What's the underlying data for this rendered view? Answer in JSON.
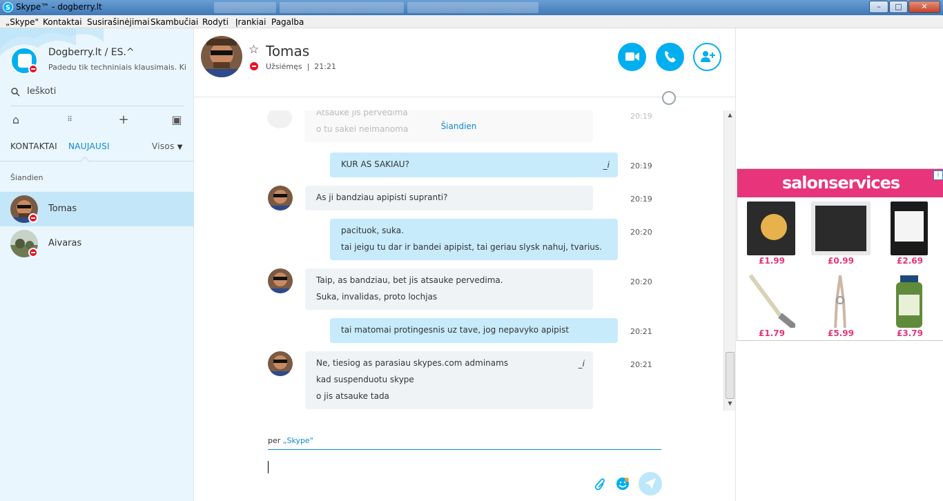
{
  "window": {
    "title": "Skype™ - dogberry.lt",
    "minimize": "–",
    "maximize": "□",
    "close": "✕"
  },
  "menu": [
    "„Skype\"",
    "Kontaktai",
    "Susirašinėjimai",
    "Skambučiai",
    "Rodyti",
    "Įrankiai",
    "Pagalba"
  ],
  "profile": {
    "name": "Dogberry.lt / ES.^",
    "mood": "Padedu tik techniniais klausimais. Ki..."
  },
  "search": {
    "label": "Ieškoti",
    "icon": "search-icon"
  },
  "nav_icons": [
    "home-icon",
    "dialpad-icon",
    "add-icon",
    "bot-icon"
  ],
  "tabs": {
    "contacts": "KONTAKTAI",
    "recent": "NAUJAUSI",
    "filter": "Visos"
  },
  "section_label": "Šiandien",
  "contacts": [
    {
      "name": "Tomas",
      "status": "dnd",
      "active": true
    },
    {
      "name": "Aivaras",
      "status": "dnd",
      "active": false
    }
  ],
  "chat": {
    "contact_name": "Tomas",
    "status_text": "Užsiėmęs",
    "time": "21:21",
    "day_separator": "Šiandien",
    "faded_lines": [
      "Atsauke jis pervedima",
      "o tu sakei neimanoma"
    ],
    "faded_time": "20:19",
    "messages": [
      {
        "dir": "out",
        "lines": [
          "KUR AS SAKIAU?"
        ],
        "time": "20:19",
        "edited": true
      },
      {
        "dir": "in",
        "lines": [
          "As ji bandziau apipisti supranti?"
        ],
        "time": "20:19",
        "edited": false
      },
      {
        "dir": "out",
        "lines": [
          "pacituok, suka.",
          "tai jeigu tu dar ir bandei apipist, tai geriau slysk nahuj, tvarius."
        ],
        "time": "20:20",
        "edited": false
      },
      {
        "dir": "in",
        "lines": [
          "Taip, as bandziau, bet jis atsauke pervedima.",
          "Suka, invalidas, proto lochjas"
        ],
        "time": "20:20",
        "edited": false
      },
      {
        "dir": "out",
        "lines": [
          "tai matomai protingesnis uz tave, jog nepavyko apipist"
        ],
        "time": "20:21",
        "edited": false
      },
      {
        "dir": "in",
        "lines": [
          "Ne, tiesiog as parasiau skypes.com adminams",
          "kad suspenduotu skype",
          "o jis atsauke tada"
        ],
        "time": "20:21",
        "edited": true
      }
    ],
    "edited_mark": "_i",
    "composer_via_prefix": "per",
    "composer_via_service": "„Skype\"",
    "header_buttons": [
      "video-call-icon",
      "audio-call-icon",
      "add-person-icon"
    ]
  },
  "ad": {
    "brand": "salonservices",
    "products": [
      {
        "name": "mask sponges",
        "price": "£1.99",
        "color": "#2b2b2b"
      },
      {
        "name": "cotton buds",
        "price": "£0.99",
        "color": "#2b2b2b"
      },
      {
        "name": "headband",
        "price": "£2.69",
        "color": "#1a1a1a"
      },
      {
        "name": "brush",
        "price": "£1.79",
        "color": "#d8d2b8"
      },
      {
        "name": "nippers",
        "price": "£5.99",
        "color": "#cdb7a4"
      },
      {
        "name": "oil",
        "price": "£3.79",
        "color": "#5f8b3a"
      }
    ]
  },
  "colors": {
    "accent": "#00aff0",
    "dnd": "#e81123",
    "ad_pink": "#e8347b"
  }
}
